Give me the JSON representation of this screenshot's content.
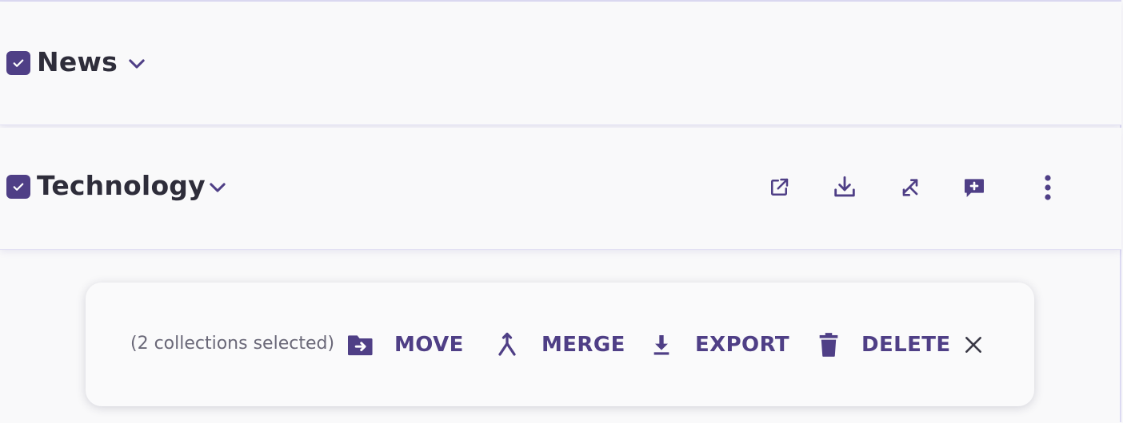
{
  "colors": {
    "accent": "#4f3f86",
    "title_text": "#2e2d3a",
    "muted_text": "#6a6878",
    "background": "#f9f9fa"
  },
  "collections": [
    {
      "name": "News",
      "checked": true,
      "icons": [
        "checkbox-icon",
        "chevron-down-icon"
      ]
    },
    {
      "name": "Technology",
      "checked": true,
      "icons": [
        "checkbox-icon",
        "chevron-down-icon"
      ],
      "actions": [
        {
          "icon": "open-external-icon"
        },
        {
          "icon": "download-icon"
        },
        {
          "icon": "sync-icon"
        },
        {
          "icon": "add-comment-icon"
        },
        {
          "icon": "more-vertical-icon"
        }
      ]
    }
  ],
  "selection_toolbar": {
    "count_text": "(2 collections selected)",
    "buttons": [
      {
        "label": "MOVE",
        "icon": "folder-move-icon"
      },
      {
        "label": "MERGE",
        "icon": "merge-icon"
      },
      {
        "label": "EXPORT",
        "icon": "download-icon"
      },
      {
        "label": "DELETE",
        "icon": "trash-icon"
      }
    ],
    "close_icon": "close-icon"
  }
}
